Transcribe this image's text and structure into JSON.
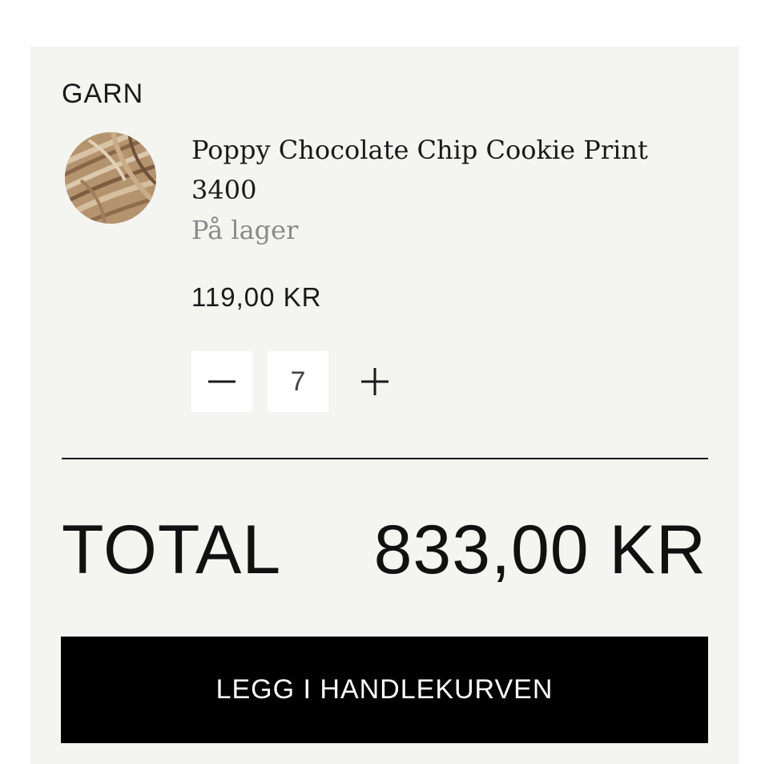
{
  "category": "GARN",
  "product": {
    "name": "Poppy Chocolate Chip Cookie Print 3400",
    "stock_status": "På lager",
    "price": "119,00 KR",
    "quantity": "7",
    "thumbnail_icon": "yarn-ball-image"
  },
  "quantity_controls": {
    "decrement_icon": "minus-icon",
    "increment_icon": "plus-icon"
  },
  "total": {
    "label": "TOTAL",
    "value": "833,00 KR"
  },
  "cta": {
    "label": "LEGG I HANDLEKURVEN"
  },
  "colors": {
    "panel_background": "#f4f4f1",
    "cta_background": "#000000",
    "cta_text": "#ffffff",
    "stock_text": "#8a8a8a"
  }
}
